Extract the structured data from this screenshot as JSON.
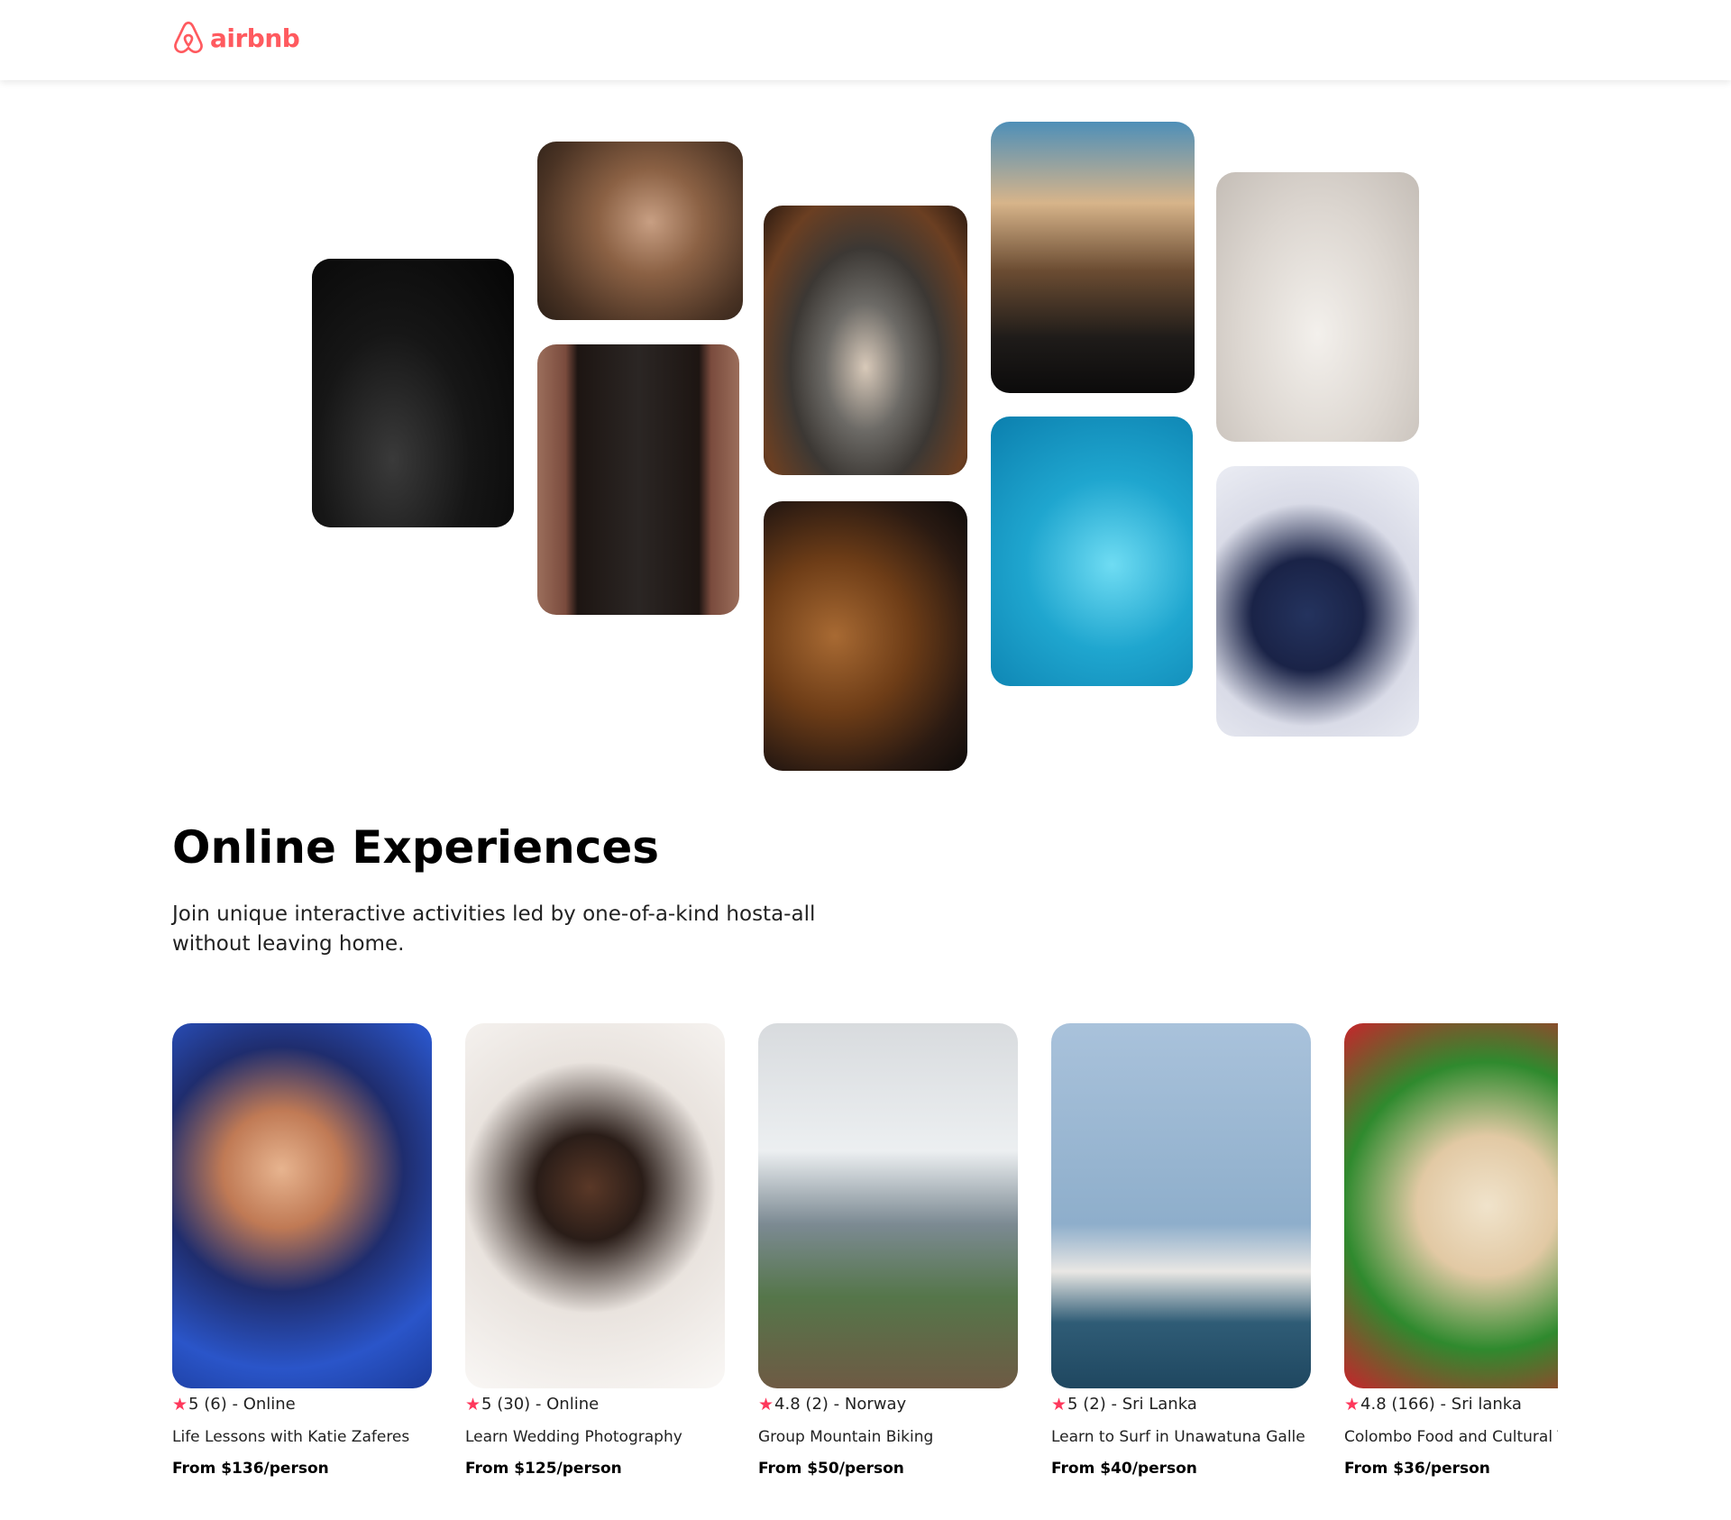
{
  "brand": {
    "name": "airbnb",
    "color": "#ff5a5f"
  },
  "hero": {
    "images": [
      {
        "icon": "cooking-hands-photo"
      },
      {
        "icon": "baker-woman-photo"
      },
      {
        "icon": "dancer-doorway-photo"
      },
      {
        "icon": "spice-bowl-photo"
      },
      {
        "icon": "acoustic-guitar-photo"
      },
      {
        "icon": "piano-microphone-photo"
      },
      {
        "icon": "swimmer-pool-photo"
      },
      {
        "icon": "yoga-woman-photo"
      },
      {
        "icon": "singer-microphone-photo"
      }
    ]
  },
  "main": {
    "title": "Online Experiences",
    "subtitle": "Join unique interactive activities led by one-of-a-kind hosta-all without leaving home."
  },
  "experiences": [
    {
      "rating": "5",
      "reviews": "(6)",
      "location": "Online",
      "title": "Life Lessons with Katie Zaferes",
      "price": "From $136/person",
      "icon": "triathlete-photo"
    },
    {
      "rating": "5",
      "reviews": "(30)",
      "location": "Online",
      "title": "Learn Wedding Photography",
      "price": "From $125/person",
      "icon": "wedding-couple-photo"
    },
    {
      "rating": "4.8",
      "reviews": "(2)",
      "location": "Norway",
      "title": "Group Mountain Biking",
      "price": "From $50/person",
      "icon": "mountain-biker-photo"
    },
    {
      "rating": "5",
      "reviews": "(2)",
      "location": "Sri Lanka",
      "title": "Learn to Surf in Unawatuna Galle",
      "price": "From $40/person",
      "icon": "surfer-photo"
    },
    {
      "rating": "4.8",
      "reviews": "(166)",
      "location": "Sri lanka",
      "title": "Colombo Food and Cultural To",
      "price": "From $36/person",
      "icon": "flatbread-photo"
    }
  ],
  "colors": {
    "star": "#fe385c",
    "title": "#000000",
    "text": "#222222"
  }
}
